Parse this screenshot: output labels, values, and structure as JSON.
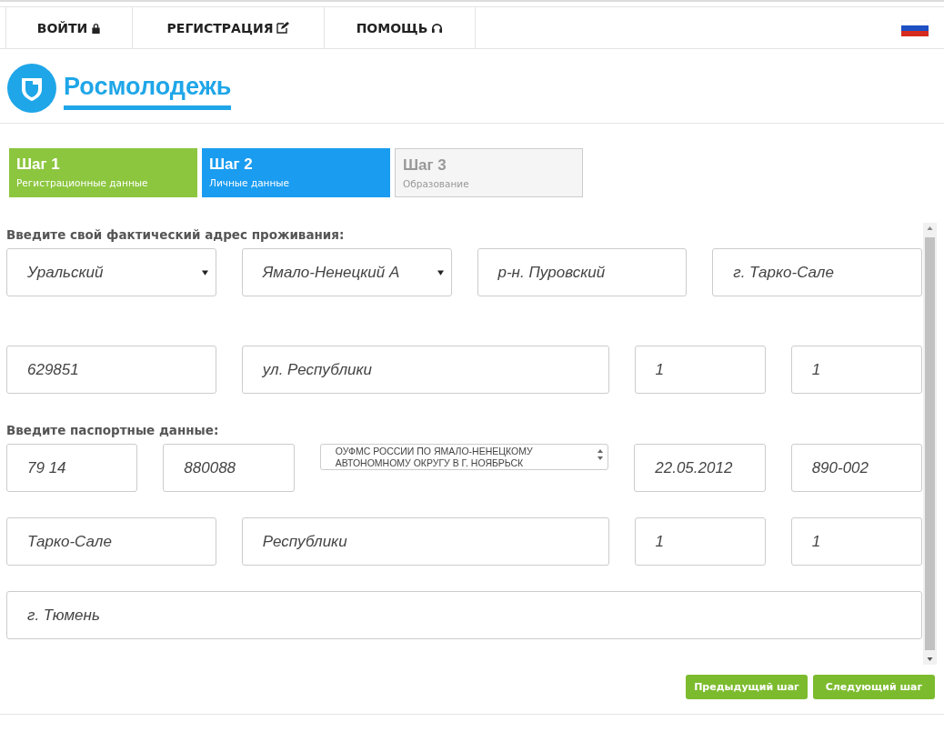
{
  "nav": [
    {
      "label": "ВОЙТИ"
    },
    {
      "label": "РЕГИСТРАЦИЯ"
    },
    {
      "label": "ПОМОЩЬ"
    }
  ],
  "logo": {
    "text": "Росмолодежь"
  },
  "steps": [
    {
      "title": "Шаг 1",
      "subtitle": "Регистрационные данные",
      "completed": true,
      "selected": false
    },
    {
      "title": "Шаг 2",
      "subtitle": "Личные данные",
      "completed": false,
      "selected": true
    },
    {
      "title": "Шаг 3",
      "subtitle": "Образование",
      "completed": false,
      "selected": false
    }
  ],
  "sections": [
    {
      "label": "Введите свой фактический адрес проживания:",
      "rows": [
        {
          "fields": [
            {
              "kind": "select",
              "value": "Уральский"
            },
            {
              "kind": "select",
              "value": "Ямало-Ненецкий А"
            },
            {
              "kind": "input",
              "value": "р-н. Пуровский"
            },
            {
              "kind": "input",
              "value": "г. Тарко-Сале"
            }
          ]
        },
        {
          "fields": [
            {
              "kind": "input",
              "value": "629851"
            },
            {
              "kind": "input",
              "value": "ул. Республики"
            },
            {
              "kind": "input",
              "value": "1"
            },
            {
              "kind": "input",
              "value": "1"
            }
          ]
        }
      ]
    },
    {
      "label": "Введите паспортные данные:",
      "rows": [
        {
          "fields": [
            {
              "kind": "input",
              "value": "79 14"
            },
            {
              "kind": "input",
              "value": "880088"
            },
            {
              "kind": "textarea",
              "value": "ОУФМС РОССИИ ПО ЯМАЛО-НЕНЕЦКОМУ АВТОНОМНОМУ ОКРУГУ В Г. НОЯБРЬСК"
            },
            {
              "kind": "input",
              "value": "22.05.2012"
            },
            {
              "kind": "input",
              "value": "890-002"
            }
          ]
        },
        {
          "fields": [
            {
              "kind": "input",
              "value": "Тарко-Сале"
            },
            {
              "kind": "input",
              "value": "Республики"
            },
            {
              "kind": "input",
              "value": "1"
            },
            {
              "kind": "input",
              "value": "1"
            }
          ]
        },
        {
          "fields": [
            {
              "kind": "input",
              "value": "г. Тюмень"
            }
          ]
        }
      ]
    }
  ],
  "buttons": [
    {
      "label": "Предыдущий шаг"
    },
    {
      "label": "Следующий шаг"
    }
  ]
}
